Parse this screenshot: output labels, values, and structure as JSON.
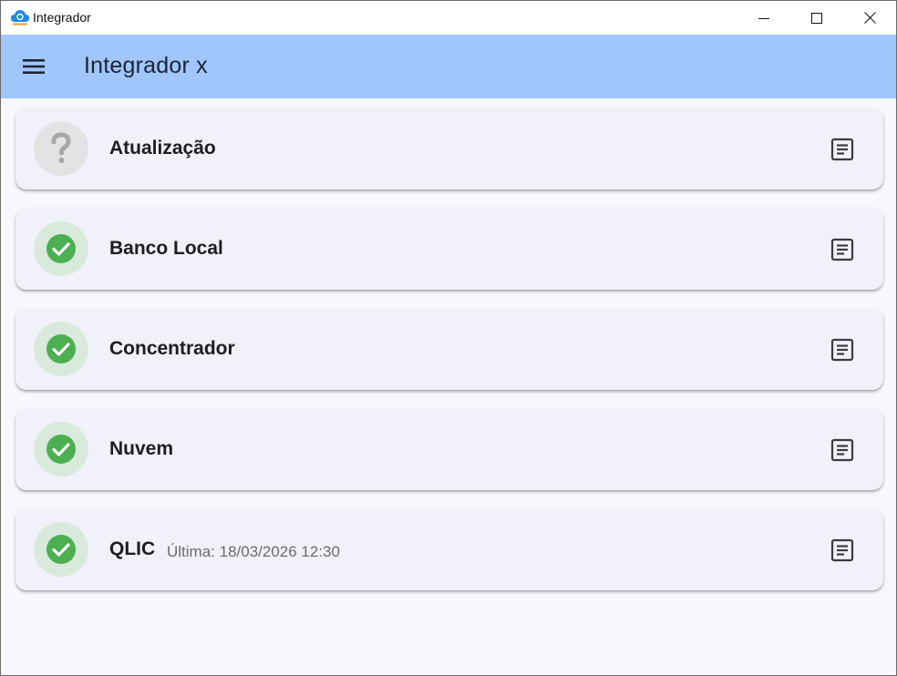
{
  "window": {
    "title": "Integrador",
    "controls": {
      "minimize_icon": "minimize-icon",
      "maximize_icon": "maximize-icon",
      "close_icon": "close-icon"
    }
  },
  "appbar": {
    "title": "Integrador x",
    "menu_icon": "menu-icon",
    "background": "#a0c6fb"
  },
  "services": [
    {
      "name": "Atualização",
      "status": "unknown",
      "subtitle": "",
      "status_icon": "question-mark-icon",
      "action_icon": "log-icon"
    },
    {
      "name": "Banco Local",
      "status": "ok",
      "subtitle": "",
      "status_icon": "check-circle-icon",
      "action_icon": "log-icon"
    },
    {
      "name": "Concentrador",
      "status": "ok",
      "subtitle": "",
      "status_icon": "check-circle-icon",
      "action_icon": "log-icon"
    },
    {
      "name": "Nuvem",
      "status": "ok",
      "subtitle": "",
      "status_icon": "check-circle-icon",
      "action_icon": "log-icon"
    },
    {
      "name": "QLIC",
      "status": "ok",
      "subtitle": "Última: 18/03/2026 12:30",
      "status_icon": "check-circle-icon",
      "action_icon": "log-icon"
    }
  ],
  "colors": {
    "ok_green": "#4caf50",
    "ok_bg": "#d9eadd",
    "unknown_gray": "#a8a8ac",
    "unknown_bg": "#e3e3e6"
  }
}
